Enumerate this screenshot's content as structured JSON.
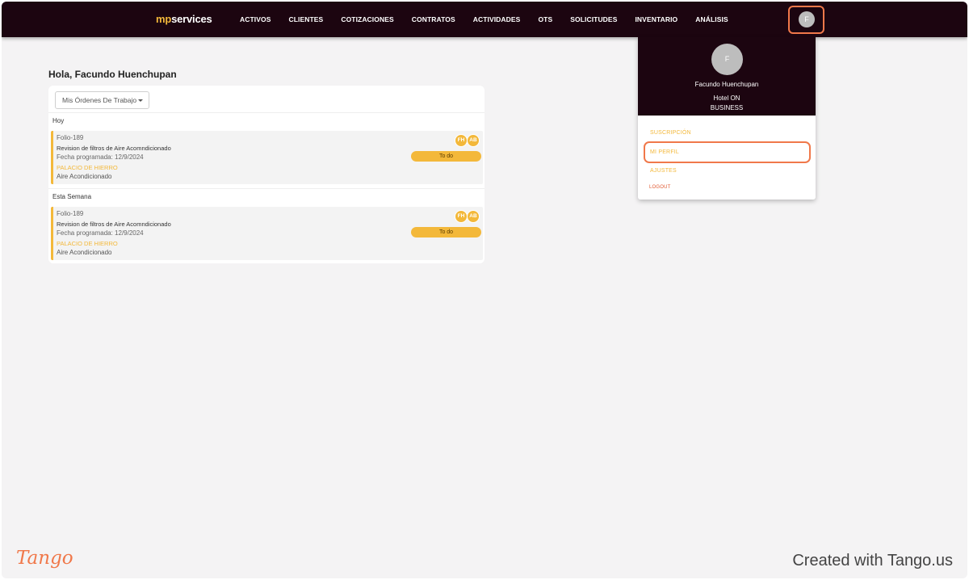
{
  "brand": {
    "prefix": "mp",
    "suffix": "services"
  },
  "nav": [
    "ACTIVOS",
    "CLIENTES",
    "COTIZACIONES",
    "CONTRATOS",
    "ACTIVIDADES",
    "OTS",
    "SOLICITUDES",
    "INVENTARIO",
    "ANÁLISIS"
  ],
  "user": {
    "initial": "F",
    "name": "Facundo Huenchupan",
    "org": "Hotel ON",
    "plan": "BUSINESS"
  },
  "main": {
    "greeting": "Hola, Facundo Huenchupan",
    "filter_value": "Mis Órdenes De Trabajo",
    "sections": [
      {
        "label": "Hoy",
        "card": {
          "folio": "Folio-189",
          "title": "Revision de filtros de Aire Acomndicionado",
          "date": "Fecha programada: 12/9/2024",
          "location": "PALACIO DE HIERRO",
          "category": "Aire Acondicionado",
          "assignees": [
            "FH",
            "AB"
          ],
          "status": "To do"
        }
      },
      {
        "label": "Esta Semana",
        "card": {
          "folio": "Folio-189",
          "title": "Revision de filtros de Aire Acomndicionado",
          "date": "Fecha programada: 12/9/2024",
          "location": "PALACIO DE HIERRO",
          "category": "Aire Acondicionado",
          "assignees": [
            "FH",
            "AB"
          ],
          "status": "To do"
        }
      }
    ]
  },
  "menu": {
    "items": [
      "SUSCRIPCIÓN",
      "MI PERFIL",
      "AJUSTES",
      "LOGOUT"
    ]
  },
  "footer": {
    "logo": "Tango",
    "text": "Created with Tango.us"
  },
  "colors": {
    "topbar": "#1c0510",
    "accent": "#f3b83a",
    "highlight": "#f0784a"
  },
  "icons": {
    "filter_caret": "caret-down-icon"
  }
}
